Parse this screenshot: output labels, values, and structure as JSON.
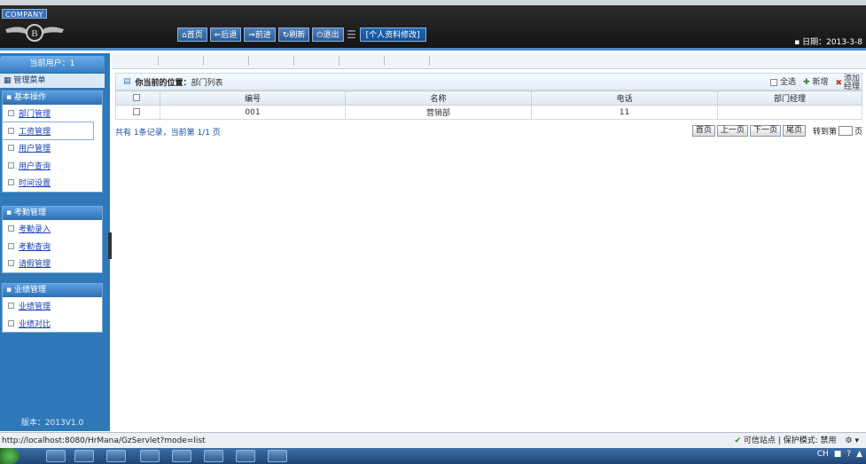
{
  "banner": {
    "company": "COMPANY",
    "nav": [
      "首页",
      "后退",
      "前进",
      "刷新",
      "退出"
    ],
    "nav_icons": [
      "home-icon",
      "back-arrow-icon",
      "forward-arrow-icon",
      "refresh-icon",
      "power-icon"
    ],
    "profile_button": "[个人资料修改]",
    "date": "日期：2013-3-8"
  },
  "sidebar": {
    "current_user": "当前用户：1",
    "menu_title": "管理菜单",
    "groups": [
      {
        "title": "基本操作",
        "items": [
          "部门管理",
          "工资管理",
          "用户管理",
          "用户查询",
          "时间设置"
        ]
      },
      {
        "title": "考勤管理",
        "items": [
          "考勤录入",
          "考勤查询",
          "请假管理"
        ]
      },
      {
        "title": "业绩管理",
        "items": [
          "业绩管理",
          "业绩对比"
        ]
      }
    ],
    "version": "版本：2013V1.0"
  },
  "content": {
    "location_label": "你当前的位置：",
    "location_value": "部门列表",
    "tools": {
      "select_all": "全选",
      "new": "新增",
      "add_manager": "添加经理"
    },
    "columns": [
      "编号",
      "名称",
      "电话",
      "部门经理"
    ],
    "rows": [
      {
        "id": "001",
        "name": "营销部",
        "phone": "11",
        "manager": ""
      }
    ],
    "pager": {
      "summary": "共有 1条记录，当前第 1/1 页",
      "first": "首页",
      "prev": "上一页",
      "next": "下一页",
      "last": "尾页",
      "goto": "转到第",
      "page_suffix": "页"
    }
  },
  "statusbar": {
    "url": "http://localhost:8080/HrMana/GzServlet?mode=list",
    "trust": "可信站点 | 保护模式: 禁用"
  },
  "taskbar": {
    "lang": "CH"
  }
}
